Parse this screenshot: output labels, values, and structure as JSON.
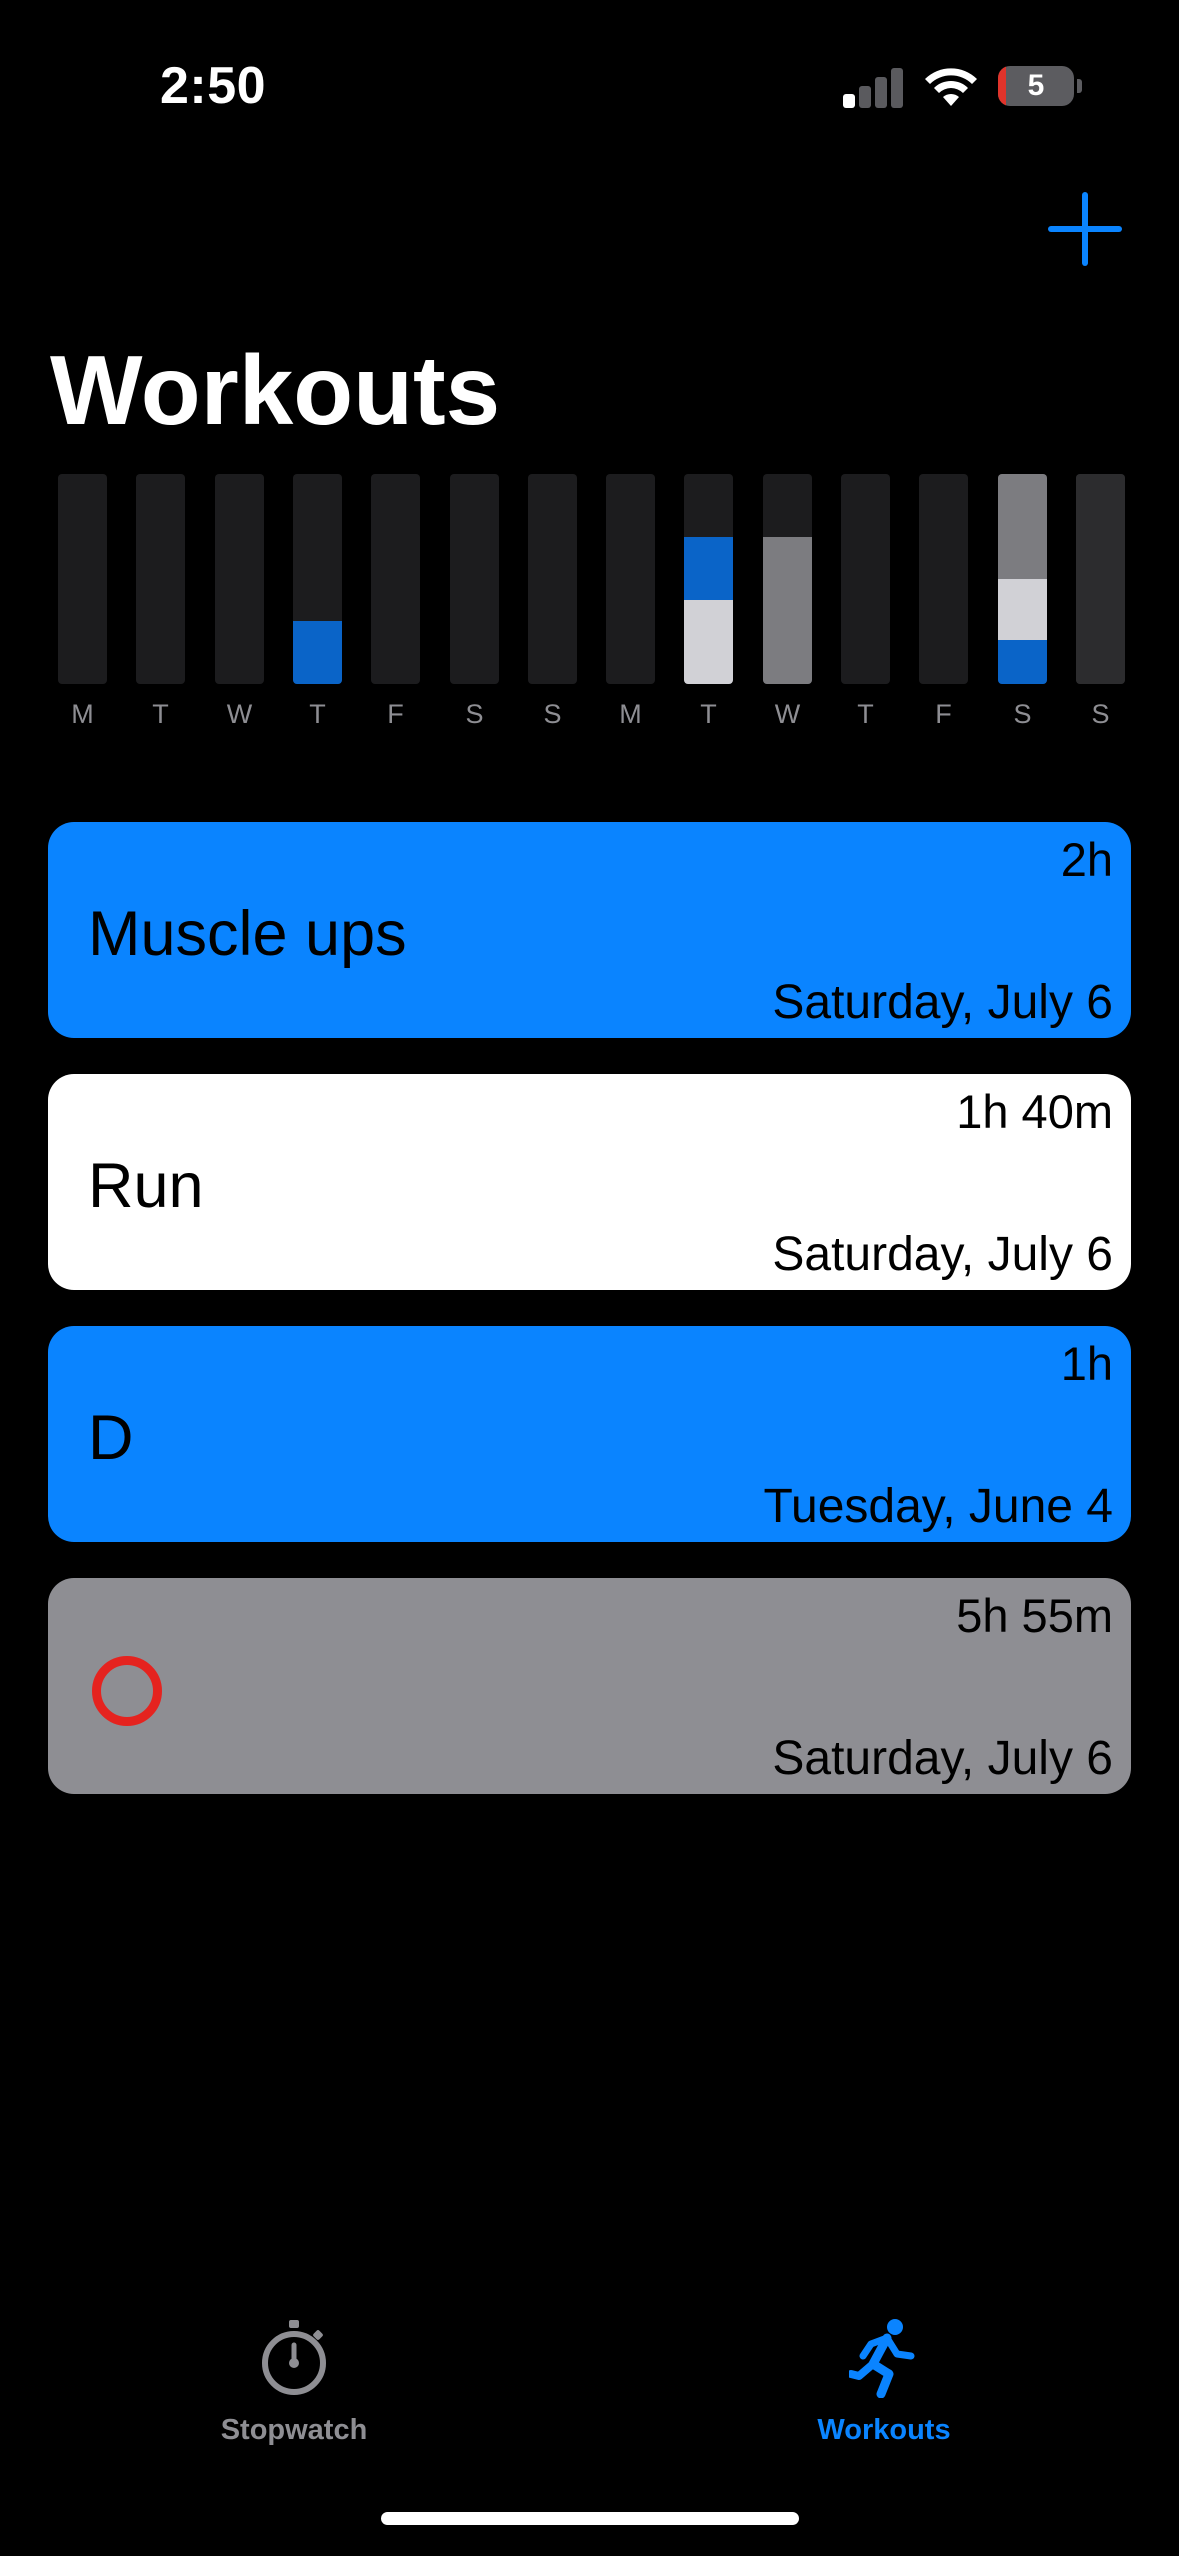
{
  "status": {
    "time": "2:50",
    "battery": "5"
  },
  "header": {
    "title": "Workouts"
  },
  "colors": {
    "accent": "#0a84ff",
    "bar_empty": "#1c1c1e",
    "chart_blue": "#0a64c8",
    "chart_light": "#d1d1d6",
    "chart_gray": "#7c7c80",
    "chart_dark": "#2c2c2e"
  },
  "chart_data": {
    "type": "bar",
    "categories": [
      "M",
      "T",
      "W",
      "T",
      "F",
      "S",
      "S",
      "M",
      "T",
      "W",
      "T",
      "F",
      "S",
      "S"
    ],
    "stacked": true,
    "values_fraction_filled": [
      [],
      [],
      [],
      [
        {
          "color": "#0a64c8",
          "value": 0.3
        }
      ],
      [],
      [],
      [],
      [],
      [
        {
          "color": "#d1d1d6",
          "value": 0.4
        },
        {
          "color": "#0a64c8",
          "value": 0.3
        }
      ],
      [
        {
          "color": "#7c7c80",
          "value": 0.7
        }
      ],
      [],
      [],
      [
        {
          "color": "#0a64c8",
          "value": 0.21
        },
        {
          "color": "#d1d1d6",
          "value": 0.29
        },
        {
          "color": "#7c7c80",
          "value": 0.5
        }
      ],
      [
        {
          "color": "#2c2c2e",
          "value": 1.0
        }
      ]
    ]
  },
  "workouts": [
    {
      "name": "Muscle ups",
      "duration": "2h",
      "date": "Saturday, July 6",
      "color": "#0a84ff",
      "icon": ""
    },
    {
      "name": "Run",
      "duration": "1h 40m",
      "date": "Saturday, July 6",
      "color": "#ffffff",
      "icon": ""
    },
    {
      "name": "D",
      "duration": "1h",
      "date": "Tuesday, June 4",
      "color": "#0a84ff",
      "icon": ""
    },
    {
      "name": "",
      "duration": "5h 55m",
      "date": "Saturday, July 6",
      "color": "#8e8e93",
      "icon": "red-ring-icon"
    }
  ],
  "tabbar": {
    "stopwatch": {
      "label": "Stopwatch",
      "icon": "stopwatch-icon"
    },
    "workouts": {
      "label": "Workouts",
      "icon": "running-figure-icon",
      "selected": true
    }
  }
}
